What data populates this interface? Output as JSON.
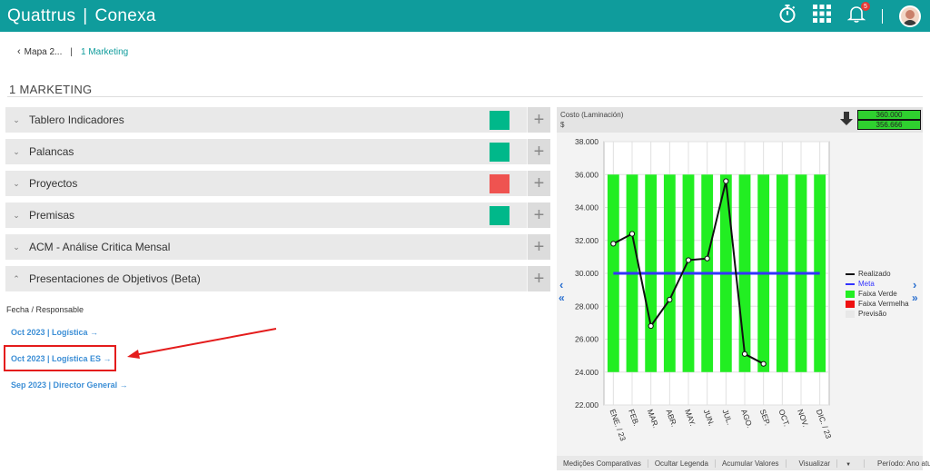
{
  "header": {
    "brand_left": "Quattrus",
    "brand_sep": "|",
    "brand_right": "Conexa",
    "notification_count": "5",
    "accent_color": "#0f9c9c"
  },
  "breadcrumb": {
    "back": "Mapa 2...",
    "separator": "|",
    "current": "1 Marketing"
  },
  "page_title": "1 MARKETING",
  "panels": [
    {
      "title": "Tablero Indicadores",
      "status_color": "#00b88a"
    },
    {
      "title": "Palancas",
      "status_color": "#00b88a"
    },
    {
      "title": "Proyectos",
      "status_color": "#ef5350"
    },
    {
      "title": "Premisas",
      "status_color": "#00b88a"
    },
    {
      "title": "ACM - Análise Critica Mensal",
      "status_color": ""
    },
    {
      "title": "Presentaciones de Objetivos (Beta)",
      "status_color": ""
    }
  ],
  "presentations": {
    "label": "Fecha / Responsable",
    "items": [
      "Oct 2023 | Logística →",
      "Oct 2023 | Logística ES →",
      "Sep 2023 | Director General →"
    ]
  },
  "chart_header": {
    "title": "Costo (Laminación)",
    "unit": "$",
    "value_top": "360.000",
    "value_bottom": "356.666"
  },
  "chart_footer": {
    "items": [
      "Medições Comparativas",
      "Ocultar Legenda",
      "Acumular Valores",
      "Visualizar",
      "Período: Ano atual"
    ]
  },
  "chart_data": {
    "type": "bar",
    "categories": [
      "ENE. / 23",
      "FEB.",
      "MAR.",
      "ABR.",
      "MAY.",
      "JUN.",
      "JUL.",
      "AGO.",
      "SEP.",
      "OCT.",
      "NOV.",
      "DIC. / 23"
    ],
    "ylim": [
      22000,
      38000
    ],
    "yticks": [
      "22.000",
      "24.000",
      "26.000",
      "28.000",
      "30.000",
      "32.000",
      "34.000",
      "36.000",
      "38.000"
    ],
    "ytick_values": [
      22000,
      24000,
      26000,
      28000,
      30000,
      32000,
      34000,
      36000,
      38000
    ],
    "band_range": [
      24000,
      36000
    ],
    "series": [
      {
        "name": "Realizado",
        "color": "#111111",
        "values": [
          31800,
          32400,
          26800,
          28400,
          30800,
          30900,
          35600,
          25100,
          24500,
          null,
          null,
          null
        ]
      },
      {
        "name": "Meta",
        "color": "#3333ff",
        "values": [
          30000,
          30000,
          30000,
          30000,
          30000,
          30000,
          30000,
          30000,
          30000,
          30000,
          30000,
          30000
        ]
      }
    ],
    "legend": [
      {
        "name": "Realizado",
        "color": "#111111"
      },
      {
        "name": "Meta",
        "color": "#3333ff"
      },
      {
        "name": "Faixa Verde",
        "color": "#22ee22"
      },
      {
        "name": "Faixa Vermelha",
        "color": "#ee1111"
      },
      {
        "name": "Previsão",
        "color": "#f0f0f0"
      }
    ],
    "legend_position": "right",
    "grid": true
  }
}
